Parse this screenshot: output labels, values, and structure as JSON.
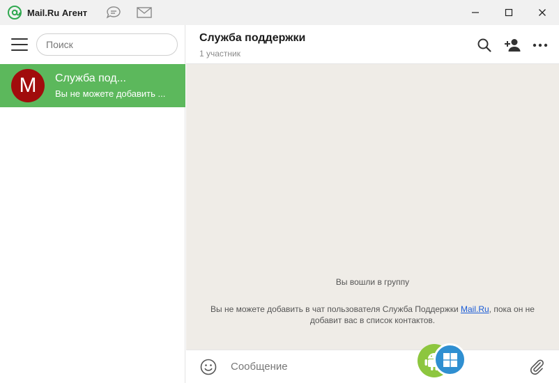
{
  "titlebar": {
    "app_title": "Mail.Ru Агент",
    "icons": [
      "at-logo-icon",
      "chat-bubble-icon",
      "envelope-icon"
    ],
    "controls": [
      "minimize-icon",
      "maximize-icon",
      "close-icon"
    ]
  },
  "sidebar": {
    "menu_icon": "hamburger-icon",
    "search": {
      "placeholder": "Поиск",
      "value": ""
    },
    "chats": [
      {
        "avatar_letter": "M",
        "avatar_color": "#a10c0c",
        "name": "Служба под...",
        "preview": "Вы не можете добавить ...",
        "selected": true
      }
    ]
  },
  "chat": {
    "title": "Служба поддержки",
    "subtitle": "1 участник",
    "header_icons": [
      "search-icon",
      "add-user-icon",
      "more-icon"
    ],
    "system_messages": {
      "joined": "Вы вошли в группу",
      "notice_before": "Вы не можете добавить в чат пользователя Служба Поддержки ",
      "notice_link": "Mail.Ru",
      "notice_after": ", пока он не добавит вас в список контактов."
    },
    "composer": {
      "placeholder": "Сообщение",
      "value": ""
    }
  },
  "colors": {
    "accent_green": "#5cb85c",
    "chat_background": "#efece7",
    "link": "#1a5bd6",
    "android_badge": "#8dc63f",
    "windows_badge": "#2f8fd1"
  },
  "overlay_badges": [
    "android-icon",
    "windows-icon"
  ]
}
